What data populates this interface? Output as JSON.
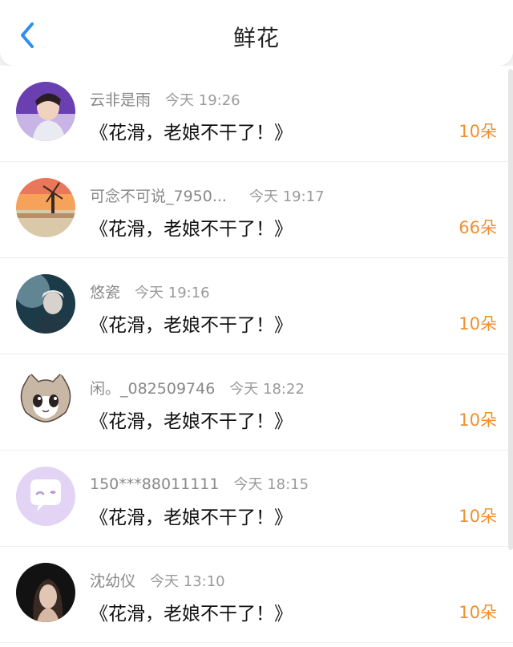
{
  "header": {
    "title": "鲜花",
    "back_icon": "chevron-left-icon",
    "accent": "#2e8fe8"
  },
  "flower_color": "#f09030",
  "items": [
    {
      "name": "云非是雨",
      "time": "今天 19:26",
      "message": "《花滑，老娘不干了！》",
      "flowers": "10朵"
    },
    {
      "name": "可念不可说_7950...",
      "time": "今天 19:17",
      "message": "《花滑，老娘不干了！》",
      "flowers": "66朵"
    },
    {
      "name": "悠瓷",
      "time": "今天 19:16",
      "message": "《花滑，老娘不干了！》",
      "flowers": "10朵"
    },
    {
      "name": "闲。_082509746",
      "time": "今天 18:22",
      "message": "《花滑，老娘不干了！》",
      "flowers": "10朵"
    },
    {
      "name": "150***88011111",
      "time": "今天 18:15",
      "message": "《花滑，老娘不干了！》",
      "flowers": "10朵"
    },
    {
      "name": "沈幼仪",
      "time": "今天 13:10",
      "message": "《花滑，老娘不干了！》",
      "flowers": "10朵"
    }
  ]
}
